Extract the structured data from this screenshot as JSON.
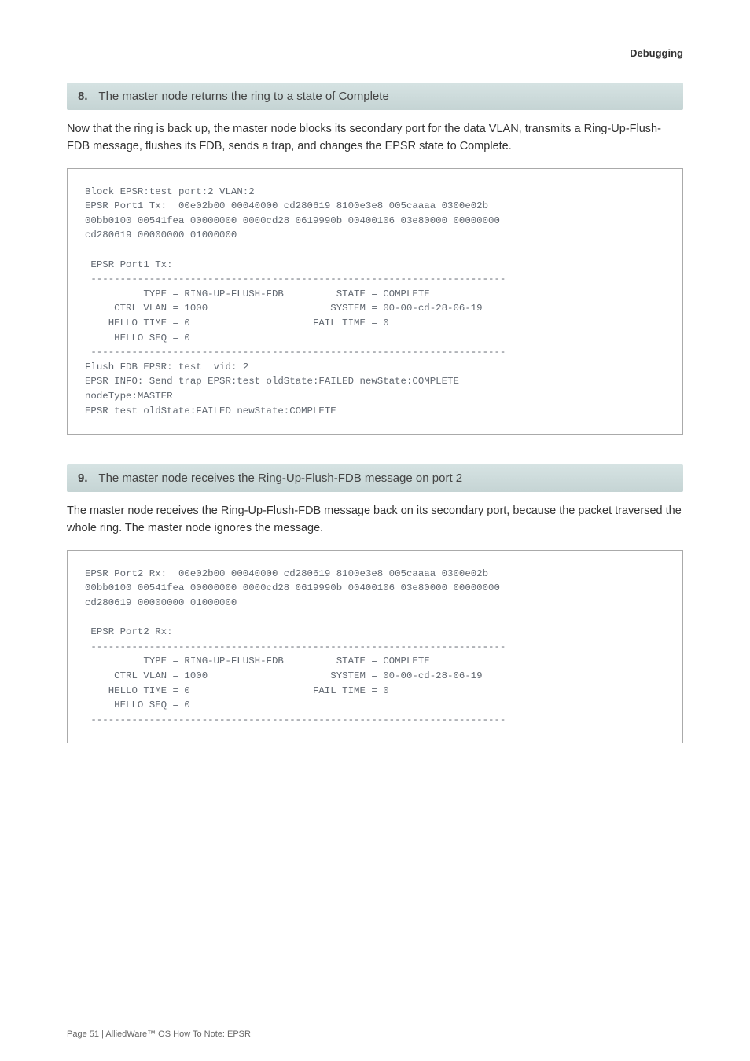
{
  "breadcrumb": "Debugging",
  "step8": {
    "num": "8.",
    "title": "The master node returns the ring to a state of Complete",
    "body": "Now that the ring is back up, the master node blocks its secondary port for the data VLAN, transmits a Ring-Up-Flush-FDB message, flushes its FDB, sends a trap, and changes the EPSR state to Complete.",
    "code": "Block EPSR:test port:2 VLAN:2\nEPSR Port1 Tx:  00e02b00 00040000 cd280619 8100e3e8 005caaaa 0300e02b\n00bb0100 00541fea 00000000 0000cd28 0619990b 00400106 03e80000 00000000\ncd280619 00000000 01000000\n\n EPSR Port1 Tx:\n -----------------------------------------------------------------------\n          TYPE = RING-UP-FLUSH-FDB         STATE = COMPLETE\n     CTRL VLAN = 1000                     SYSTEM = 00-00-cd-28-06-19\n    HELLO TIME = 0                     FAIL TIME = 0\n     HELLO SEQ = 0\n -----------------------------------------------------------------------\nFlush FDB EPSR: test  vid: 2\nEPSR INFO: Send trap EPSR:test oldState:FAILED newState:COMPLETE\nnodeType:MASTER\nEPSR test oldState:FAILED newState:COMPLETE"
  },
  "step9": {
    "num": "9.",
    "title": "The master node receives the Ring-Up-Flush-FDB message on port 2",
    "body": "The master node receives the Ring-Up-Flush-FDB message back on its secondary port, because the packet traversed the whole ring. The master node ignores the message.",
    "code": "EPSR Port2 Rx:  00e02b00 00040000 cd280619 8100e3e8 005caaaa 0300e02b\n00bb0100 00541fea 00000000 0000cd28 0619990b 00400106 03e80000 00000000\ncd280619 00000000 01000000\n\n EPSR Port2 Rx:\n -----------------------------------------------------------------------\n          TYPE = RING-UP-FLUSH-FDB         STATE = COMPLETE\n     CTRL VLAN = 1000                     SYSTEM = 00-00-cd-28-06-19\n    HELLO TIME = 0                     FAIL TIME = 0\n     HELLO SEQ = 0\n -----------------------------------------------------------------------"
  },
  "footer": "Page 51 | AlliedWare™ OS How To Note: EPSR"
}
